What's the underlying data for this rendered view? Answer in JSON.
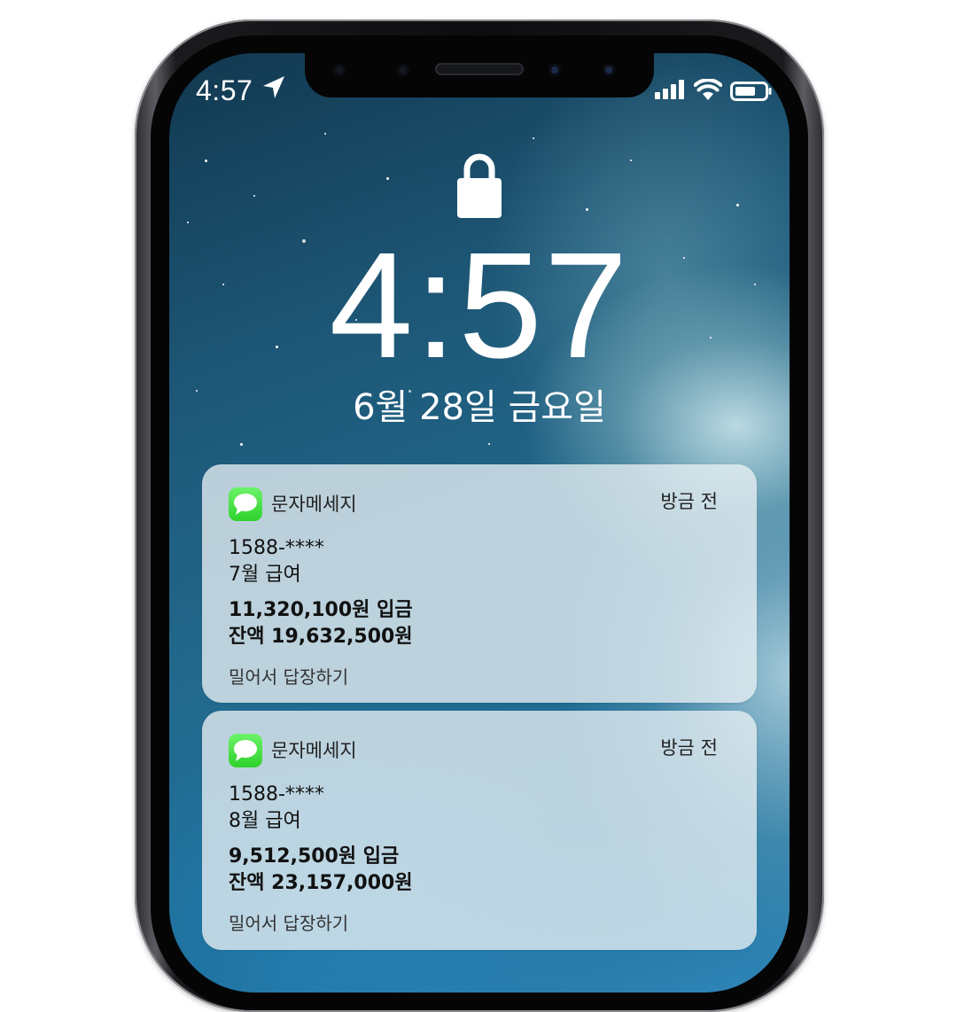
{
  "status_bar": {
    "time": "4:57",
    "location_icon": "location-arrow-icon",
    "signal_icon": "cellular-signal-icon",
    "wifi_icon": "wifi-icon",
    "battery_icon": "battery-icon"
  },
  "lock_screen": {
    "lock_icon": "lock-icon",
    "time": "4:57",
    "date": "6월 28일 금요일"
  },
  "notifications": [
    {
      "app_icon": "messages-icon",
      "app": "문자메세지",
      "time_ago": "방금 전",
      "sender": "1588-****",
      "subject": "7월 급여",
      "line1": "11,320,100원 입금",
      "line2": "잔액 19,632,500원",
      "reply_hint": "밀어서 답장하기"
    },
    {
      "app_icon": "messages-icon",
      "app": "문자메세지",
      "time_ago": "방금 전",
      "sender": "1588-****",
      "subject": "8월 급여",
      "line1": "9,512,500원 입금",
      "line2": "잔액 23,157,000원",
      "reply_hint": "밀어서 답장하기"
    }
  ],
  "colors": {
    "messages_green": "#34d432",
    "card_background": "#e8f0f4",
    "wallpaper_deep": "#1d5675"
  }
}
